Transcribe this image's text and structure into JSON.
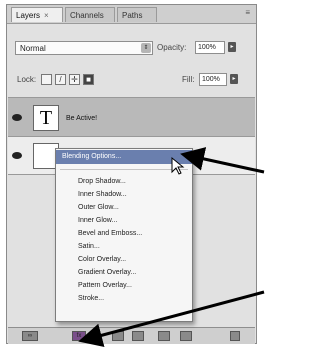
{
  "tabs": [
    {
      "label": "Layers",
      "close": "×"
    },
    {
      "label": "Channels"
    },
    {
      "label": "Paths"
    }
  ],
  "blend_mode": "Normal",
  "opacity": {
    "label": "Opacity:",
    "value": "100%"
  },
  "lock": {
    "label": "Lock:"
  },
  "fill": {
    "label": "Fill:",
    "value": "100%"
  },
  "layers": [
    {
      "name": "Be Active!",
      "thumb": "T"
    },
    {
      "name": ""
    }
  ],
  "menu": {
    "highlighted": "Blending Options...",
    "items": [
      "Drop Shadow...",
      "Inner Shadow...",
      "Outer Glow...",
      "Inner Glow...",
      "Bevel and Emboss...",
      "Satin...",
      "Color Overlay...",
      "Gradient Overlay...",
      "Pattern Overlay...",
      "Stroke..."
    ]
  },
  "colors": {
    "panel_bg": "#e1e1e1",
    "menu_highlight": "#6a7fae",
    "arrow": "#000000"
  }
}
